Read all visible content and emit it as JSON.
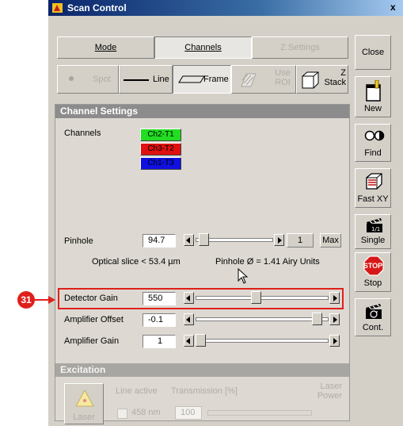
{
  "window": {
    "title": "Scan Control",
    "close_glyph": "x"
  },
  "tabs": [
    {
      "label": "Mode"
    },
    {
      "label": "Channels"
    },
    {
      "label": "Z Settings"
    }
  ],
  "scan_modes": [
    {
      "label": "Spot"
    },
    {
      "label": "Line"
    },
    {
      "label": "Frame"
    },
    {
      "label": "Use ROI"
    },
    {
      "label": "Z Stack"
    }
  ],
  "side_buttons": [
    {
      "label": "Close",
      "icon": "none"
    },
    {
      "label": "New",
      "icon": "new-document-icon"
    },
    {
      "label": "Find",
      "icon": "find-circles-icon"
    },
    {
      "label": "Fast XY",
      "icon": "fast-xy-icon"
    },
    {
      "label": "Single",
      "icon": "clapper-single-icon"
    },
    {
      "label": "Stop",
      "icon": "stop-sign-icon",
      "icon_text": "STOP"
    },
    {
      "label": "Cont.",
      "icon": "clapper-continuous-icon"
    }
  ],
  "channel_settings": {
    "header": "Channel Settings",
    "channels_label": "Channels",
    "channels": [
      {
        "label": "Ch2-T1",
        "color": "#22dd22"
      },
      {
        "label": "Ch3-T2",
        "color": "#e01010"
      },
      {
        "label": "Ch1-T3",
        "color": "#1010e0"
      }
    ],
    "pinhole": {
      "label": "Pinhole",
      "value": "94.7",
      "step_value": "1",
      "max_label": "Max",
      "level": 0.05
    },
    "optical_slice": "Optical slice < 53.4 µm",
    "pinhole_airy": "Pinhole Ø = 1.41 Airy Units",
    "detector_gain": {
      "label": "Detector Gain",
      "value": "550",
      "level": 0.45
    },
    "amplifier_offset": {
      "label": "Amplifier Offset",
      "value": "-0.1",
      "level": 0.95
    },
    "amplifier_gain": {
      "label": "Amplifier Gain",
      "value": "1",
      "level": 0.0
    }
  },
  "excitation": {
    "header": "Excitation",
    "line_active": "Line active",
    "transmission": "Transmission [%]",
    "laser_power": "Laser Power",
    "laser": "Laser",
    "line_value": "458 nm",
    "transmission_value": "100"
  },
  "callout": {
    "number": "31",
    "color": "#e0201c"
  }
}
